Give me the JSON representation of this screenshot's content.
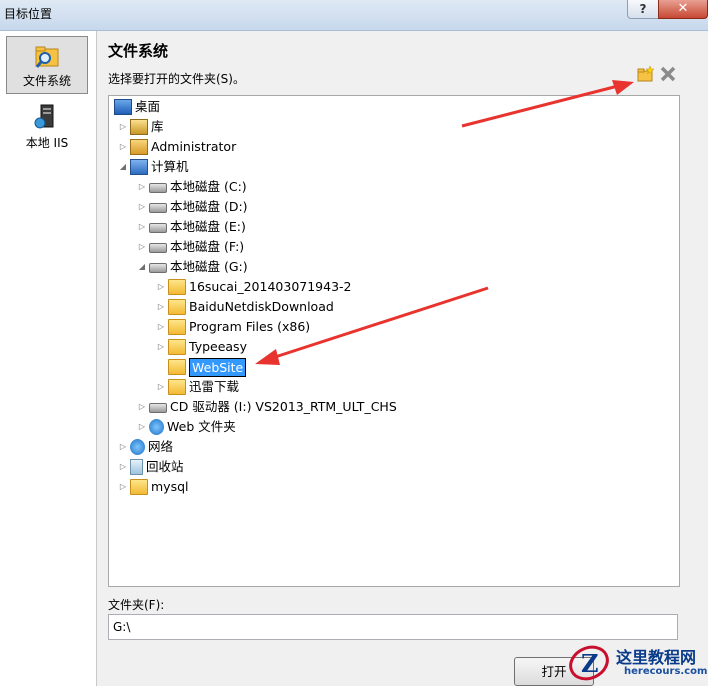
{
  "window": {
    "title": "目标位置",
    "help_label": "?",
    "close_label": "✕"
  },
  "sidebar": {
    "items": [
      {
        "label": "文件系统",
        "icon": "folder-search-icon",
        "selected": true
      },
      {
        "label": "本地 IIS",
        "icon": "server-icon",
        "selected": false
      }
    ]
  },
  "main": {
    "heading": "文件系统",
    "instruction": "选择要打开的文件夹(S)。",
    "toolbar": {
      "new_folder_icon": "new-folder-icon",
      "delete_icon": "delete-icon"
    }
  },
  "tree": {
    "nodes": [
      {
        "label": "桌面",
        "expander": ""
      },
      {
        "label": "库",
        "expander": "▷"
      },
      {
        "label": "Administrator",
        "expander": "▷"
      },
      {
        "label": "计算机",
        "expander": "◢"
      },
      {
        "label": "本地磁盘 (C:)",
        "expander": "▷"
      },
      {
        "label": "本地磁盘 (D:)",
        "expander": "▷"
      },
      {
        "label": "本地磁盘 (E:)",
        "expander": "▷"
      },
      {
        "label": "本地磁盘 (F:)",
        "expander": "▷"
      },
      {
        "label": "本地磁盘 (G:)",
        "expander": "◢"
      },
      {
        "label": "16sucai_201403071943-2",
        "expander": "▷"
      },
      {
        "label": "BaiduNetdiskDownload",
        "expander": "▷"
      },
      {
        "label": "Program Files (x86)",
        "expander": "▷"
      },
      {
        "label": "Typeeasy",
        "expander": "▷"
      },
      {
        "label": "WebSite",
        "expander": ""
      },
      {
        "label": "迅雷下载",
        "expander": "▷"
      },
      {
        "label": "CD 驱动器 (I:) VS2013_RTM_ULT_CHS",
        "expander": "▷"
      },
      {
        "label": "Web 文件夹",
        "expander": "▷"
      },
      {
        "label": "网络",
        "expander": "▷"
      },
      {
        "label": "回收站",
        "expander": "▷"
      },
      {
        "label": "mysql",
        "expander": "▷"
      }
    ]
  },
  "folder_field": {
    "label": "文件夹(F):",
    "value": "G:\\"
  },
  "buttons": {
    "open_label": "打开"
  },
  "watermark": {
    "title": "这里教程网",
    "subtitle": "herecours.com"
  },
  "colors": {
    "arrow": "#e8332e",
    "selection": "#3399ff"
  }
}
